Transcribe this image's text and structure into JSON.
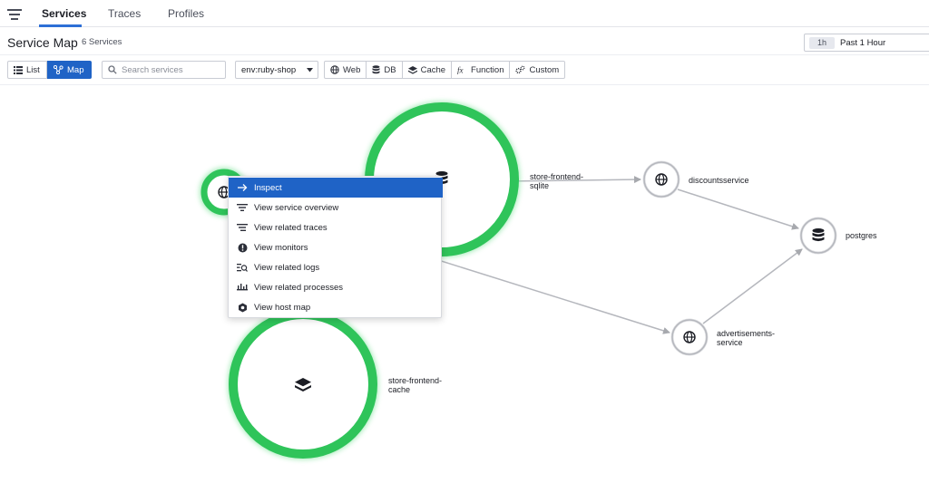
{
  "nav": {
    "tabs": [
      {
        "label": "Services"
      },
      {
        "label": "Traces"
      },
      {
        "label": "Profiles"
      }
    ],
    "active_tab": "Services"
  },
  "header": {
    "title": "Service Map",
    "count": "6 Services",
    "time": {
      "chip": "1h",
      "label": "Past 1 Hour"
    }
  },
  "toolbar": {
    "list_label": "List",
    "map_label": "Map",
    "search_placeholder": "Search services",
    "env": "env:ruby-shop",
    "filters": [
      "Web",
      "DB",
      "Cache",
      "Function",
      "Custom"
    ]
  },
  "nodes": {
    "store_frontend_sqlite": "store-frontend-\nsqlite",
    "discountsservice": "discountsservice",
    "postgres": "postgres",
    "advertisements_service": "advertisements-\nservice",
    "store_frontend_cache": "store-frontend-\ncache"
  },
  "menu": {
    "items": [
      {
        "label": "Inspect",
        "icon": "arrow-right-icon"
      },
      {
        "label": "View service overview",
        "icon": "list-filter-icon"
      },
      {
        "label": "View related traces",
        "icon": "traces-icon"
      },
      {
        "label": "View monitors",
        "icon": "monitor-alert-icon"
      },
      {
        "label": "View related logs",
        "icon": "logs-icon"
      },
      {
        "label": "View related processes",
        "icon": "processes-icon"
      },
      {
        "label": "View host map",
        "icon": "host-map-icon"
      }
    ]
  },
  "colors": {
    "accent": "#1f63c6",
    "healthy": "#2fc45a",
    "edge": "#b5b7bd"
  }
}
